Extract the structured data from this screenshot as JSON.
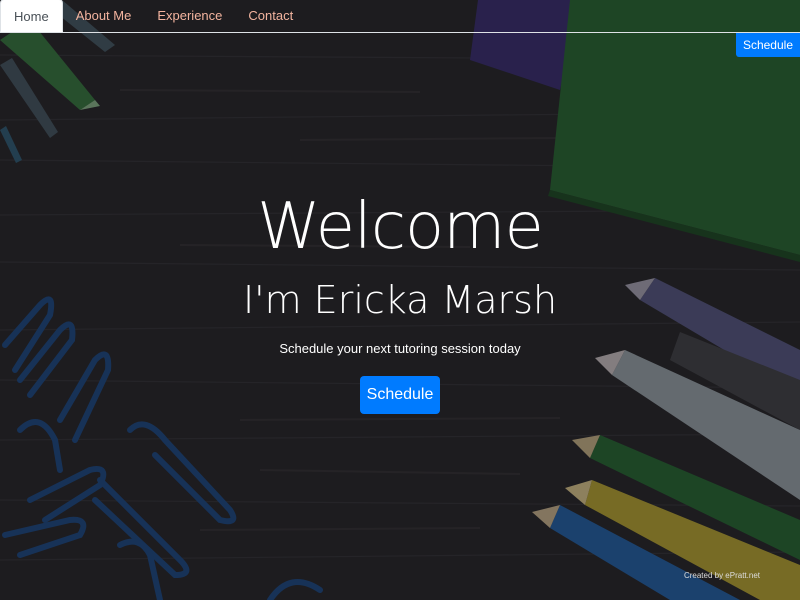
{
  "nav": {
    "items": [
      {
        "label": "Home",
        "active": true
      },
      {
        "label": "About Me",
        "active": false
      },
      {
        "label": "Experience",
        "active": false
      },
      {
        "label": "Contact",
        "active": false
      }
    ],
    "schedule_label": "Schedule"
  },
  "hero": {
    "title": "Welcome",
    "subtitle": "I'm Ericka Marsh",
    "tagline": "Schedule your next tutoring session today",
    "button_label": "Schedule"
  },
  "footer": {
    "credit": "Created by ePratt.net"
  },
  "colors": {
    "nav_text": "#f3b49f",
    "primary": "#007bff",
    "background": "#2c2b30"
  }
}
